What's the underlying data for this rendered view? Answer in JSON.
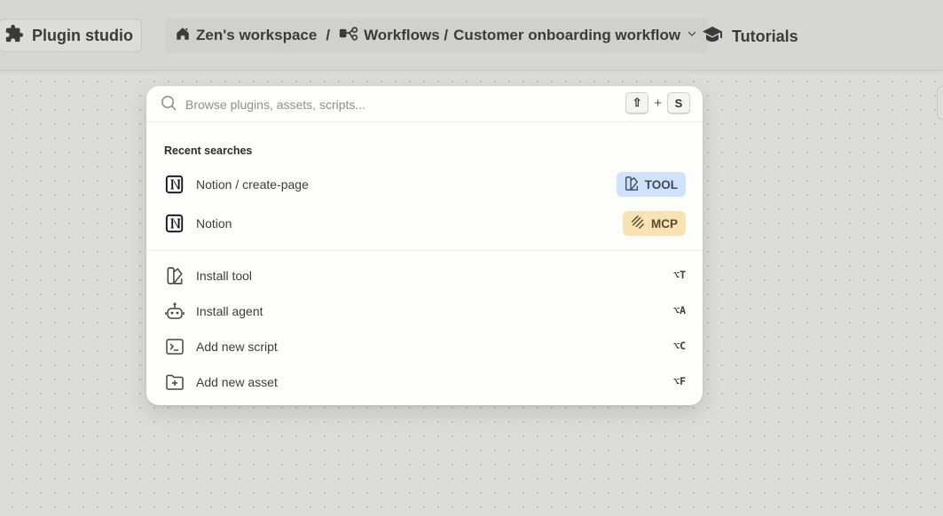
{
  "header": {
    "plugin_studio": "Plugin studio",
    "breadcrumb": {
      "workspace": "Zen's workspace",
      "sep1": "/",
      "workflows": "Workflows /",
      "current": "Customer onboarding workflow"
    },
    "tutorials": "Tutorials"
  },
  "search": {
    "placeholder": "Browse plugins, assets, scripts...",
    "shortcut": {
      "key1": "⇧",
      "plus": "+",
      "key2": "S"
    }
  },
  "recent": {
    "title": "Recent searches",
    "items": [
      {
        "label": "Notion / create-page",
        "icon": "notion-icon",
        "badge": "TOOL",
        "badge_icon": "tool-icon"
      },
      {
        "label": "Notion",
        "icon": "notion-icon",
        "badge": "MCP",
        "badge_icon": "mcp-icon"
      }
    ]
  },
  "actions": [
    {
      "label": "Install tool",
      "icon": "tool-icon",
      "shortcut": "⌥T"
    },
    {
      "label": "Install agent",
      "icon": "robot-icon",
      "shortcut": "⌥A"
    },
    {
      "label": "Add new script",
      "icon": "terminal-icon",
      "shortcut": "⌥C"
    },
    {
      "label": "Add new asset",
      "icon": "folder-plus-icon",
      "shortcut": "⌥F"
    }
  ],
  "colors": {
    "canvas": "#dcdcd9",
    "tool_badge": "#cfe2f9",
    "mcp_badge": "#f7e3b3"
  }
}
